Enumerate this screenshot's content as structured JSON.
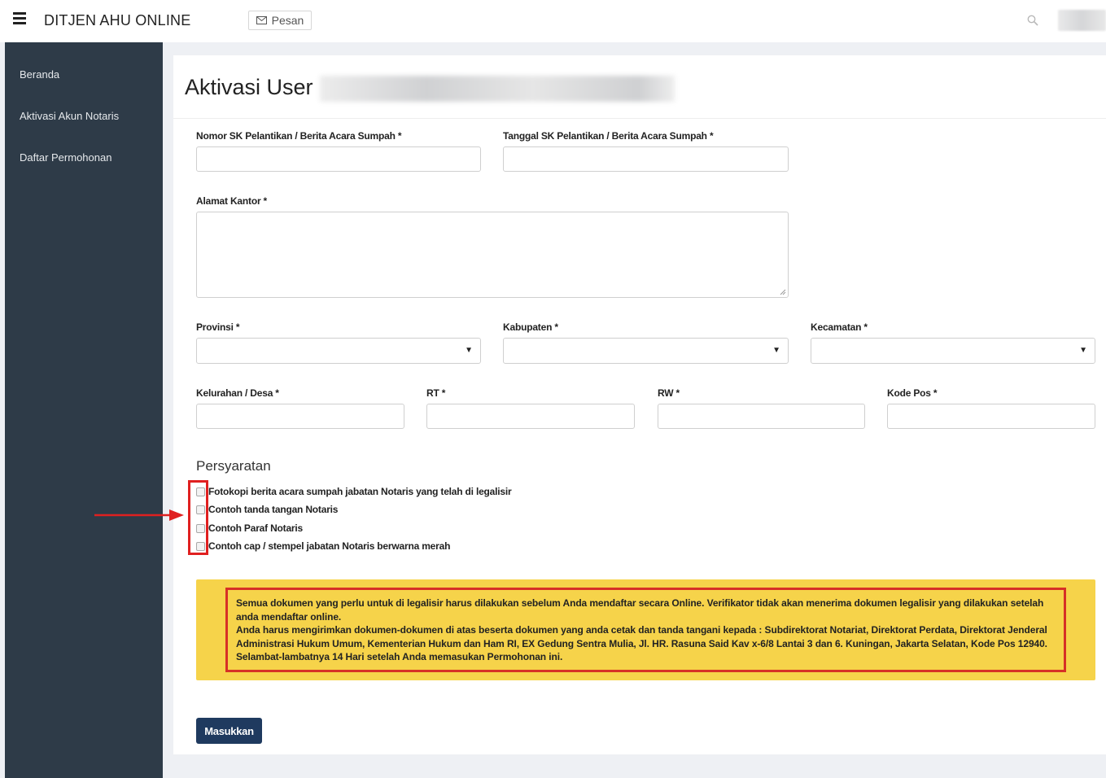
{
  "header": {
    "app_title": "DITJEN AHU ONLINE",
    "message_button_label": "Pesan"
  },
  "sidebar": {
    "items": [
      {
        "label": "Beranda"
      },
      {
        "label": "Aktivasi Akun Notaris"
      },
      {
        "label": "Daftar Permohonan"
      }
    ]
  },
  "page": {
    "title": "Aktivasi User"
  },
  "form": {
    "nomor_sk": {
      "label": "Nomor SK Pelantikan / Berita Acara Sumpah *",
      "value": ""
    },
    "tanggal_sk": {
      "label": "Tanggal SK Pelantikan / Berita Acara Sumpah *",
      "value": ""
    },
    "alamat_kantor": {
      "label": "Alamat Kantor *",
      "value": ""
    },
    "provinsi": {
      "label": "Provinsi *",
      "value": ""
    },
    "kabupaten": {
      "label": "Kabupaten *",
      "value": ""
    },
    "kecamatan": {
      "label": "Kecamatan *",
      "value": ""
    },
    "kelurahan": {
      "label": "Kelurahan / Desa *",
      "value": ""
    },
    "rt": {
      "label": "RT *",
      "value": ""
    },
    "rw": {
      "label": "RW *",
      "value": ""
    },
    "kode_pos": {
      "label": "Kode Pos *",
      "value": ""
    }
  },
  "requirements": {
    "title": "Persyaratan",
    "items": [
      {
        "label": "Fotokopi berita acara sumpah jabatan Notaris yang telah di legalisir",
        "checked": false
      },
      {
        "label": "Contoh tanda tangan Notaris",
        "checked": false
      },
      {
        "label": "Contoh Paraf Notaris",
        "checked": false
      },
      {
        "label": "Contoh cap / stempel jabatan Notaris berwarna merah",
        "checked": false
      }
    ]
  },
  "notice": {
    "paragraph1": "Semua dokumen yang perlu untuk di legalisir harus dilakukan sebelum Anda mendaftar secara Online. Verifikator tidak akan menerima dokumen legalisir yang dilakukan setelah anda mendaftar online.",
    "paragraph2": "Anda harus mengirimkan dokumen-dokumen di atas beserta dokumen yang anda cetak dan tanda tangani kepada : Subdirektorat Notariat, Direktorat Perdata, Direktorat Jenderal Administrasi Hukum Umum, Kementerian Hukum dan Ham RI, EX Gedung Sentra Mulia, Jl. HR. Rasuna Said Kav x-6/8 Lantai 3 dan 6. Kuningan, Jakarta Selatan, Kode Pos 12940. Selambat-lambatnya 14 Hari setelah Anda memasukan Permohonan ini."
  },
  "submit_label": "Masukkan",
  "colors": {
    "sidebar_bg": "#2e3b48",
    "notice_bg": "#f6d34a",
    "highlight_red": "#e02020",
    "button_bg": "#1f3a5f"
  },
  "icons": {
    "menu": "hamburger-icon",
    "message": "envelope-icon",
    "search": "search-icon"
  }
}
